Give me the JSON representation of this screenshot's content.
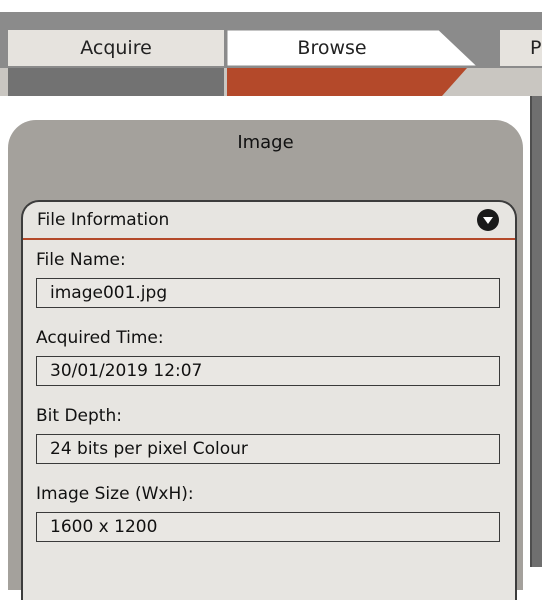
{
  "tabs": {
    "acquire": "Acquire",
    "browse": "Browse",
    "next_partial": "P"
  },
  "colors": {
    "accent": "#b4492a",
    "panel": "#a4a19c",
    "tab_inactive": "#e6e3de"
  },
  "panel": {
    "title": "Image"
  },
  "file_info": {
    "title": "File Information",
    "toggle_icon": "collapse-circle-icon",
    "fields": [
      {
        "label": "File Name:",
        "value": "image001.jpg"
      },
      {
        "label": "Acquired Time:",
        "value": "30/01/2019 12:07"
      },
      {
        "label": "Bit Depth:",
        "value": "24 bits per pixel Colour"
      },
      {
        "label": "Image Size (WxH):",
        "value": "1600 x 1200"
      }
    ]
  }
}
